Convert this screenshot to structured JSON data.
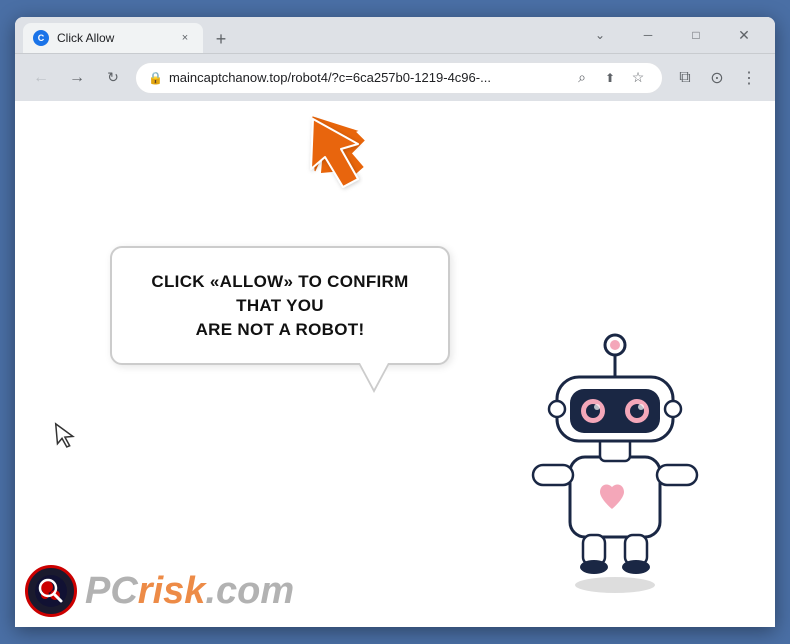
{
  "browser": {
    "tab": {
      "favicon_label": "C",
      "title": "Click Allow",
      "close_label": "×"
    },
    "new_tab_label": "+",
    "window_controls": {
      "chevron_label": "⌄",
      "minimize_label": "─",
      "maximize_label": "□",
      "close_label": "✕"
    },
    "nav": {
      "back_label": "←",
      "forward_label": "→",
      "refresh_label": "↻"
    },
    "url": {
      "lock_label": "🔒",
      "text": "maincaptchanow.top/robot4/?c=6ca257b0-1219-4c96-...",
      "search_label": "⌕",
      "share_label": "⬆",
      "bookmark_label": "☆",
      "extensions_label": "⧉",
      "profile_label": "⊙",
      "menu_label": "⋮"
    }
  },
  "page": {
    "bubble_text_line1": "CLICK «ALLOW» TO CONFIRM THAT YOU",
    "bubble_text_line2": "ARE NOT A ROBOT!",
    "arrow_color": "#E8650A",
    "robot_color_dark": "#1a2744",
    "robot_color_pink": "#f4a7b9"
  },
  "watermark": {
    "logo_symbol": "🔍",
    "text_grey": "PC",
    "text_orange": "risk",
    "text_domain": ".com"
  }
}
